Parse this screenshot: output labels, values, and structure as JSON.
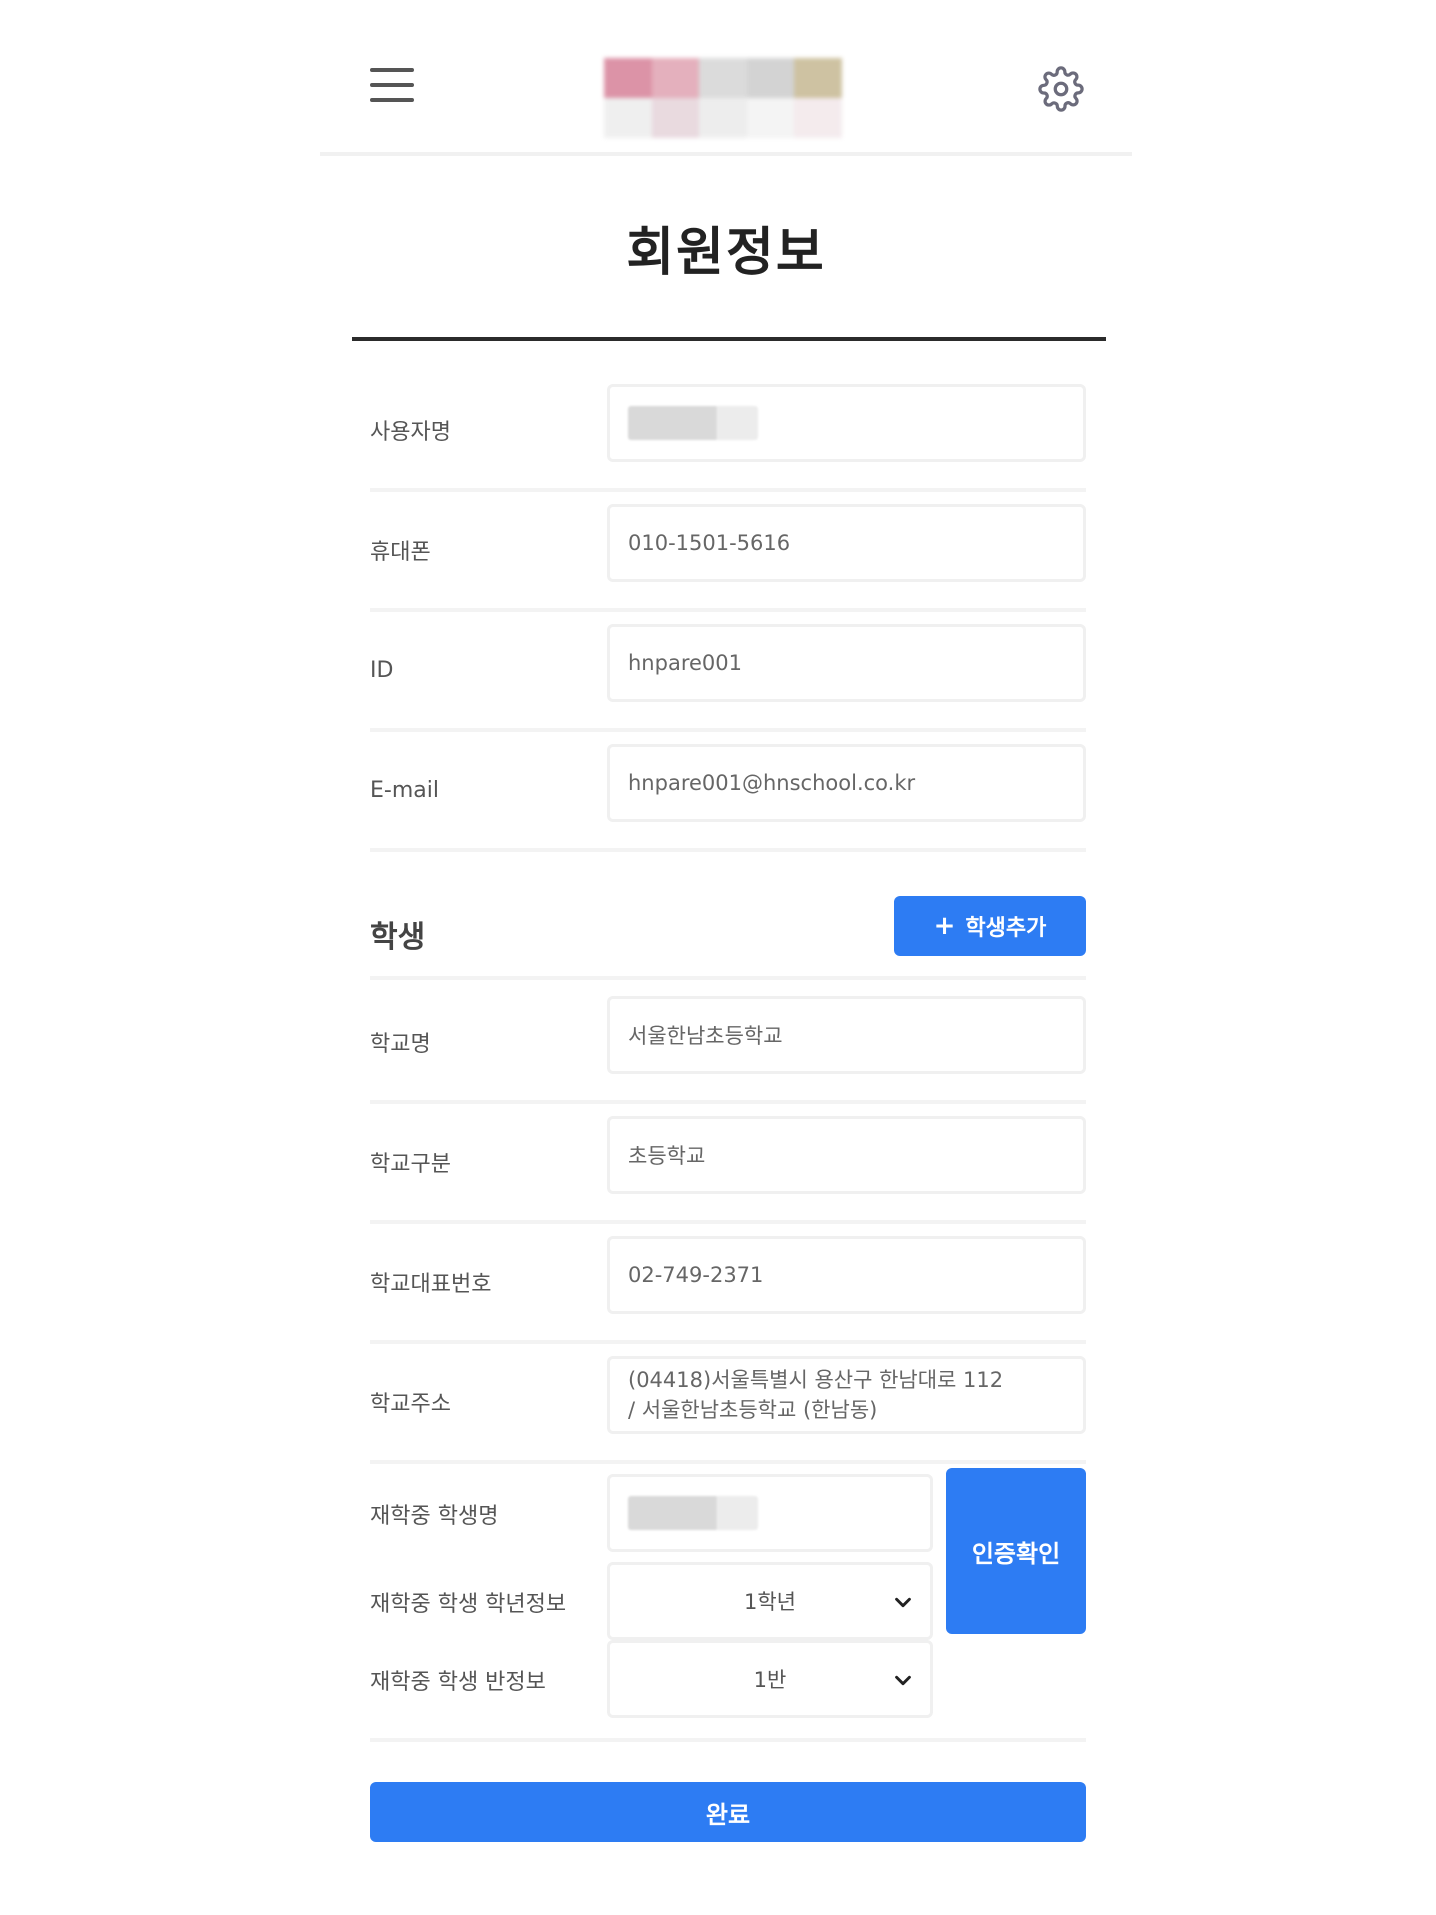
{
  "header": {
    "menu_icon": "hamburger-menu-icon",
    "logo_icon": "pixelated-logo",
    "settings_icon": "gear-icon",
    "logo_colors": [
      "#d9889e",
      "#e2a8b6",
      "#d8d8d8",
      "#cfcfcf",
      "#c9bc98",
      "#eeeeee",
      "#e7d6dc",
      "#ececec",
      "#f3f3f3",
      "#f3e9ec"
    ]
  },
  "page_title": "회원정보",
  "member": {
    "username_label": "사용자명",
    "phone_label": "휴대폰",
    "phone_value": "010-1501-5616",
    "id_label": "ID",
    "id_value": "hnpare001",
    "email_label": "E-mail",
    "email_value": "hnpare001@hnschool.co.kr"
  },
  "student": {
    "section_title": "학생",
    "add_button_label": "학생추가",
    "add_button_icon": "plus-icon",
    "school_name_label": "학교명",
    "school_name_value": "서울한남초등학교",
    "school_type_label": "학교구분",
    "school_type_value": "초등학교",
    "school_phone_label": "학교대표번호",
    "school_phone_value": "02-749-2371",
    "school_address_label": "학교주소",
    "school_address_line1": "(04418)서울특별시 용산구 한남대로 112",
    "school_address_line2": "/ 서울한남초등학교 (한남동)",
    "student_name_label": "재학중 학생명",
    "grade_label": "재학중 학생 학년정보",
    "grade_value": "1학년",
    "class_label": "재학중 학생 반정보",
    "class_value": "1반",
    "verify_button_label": "인증확인"
  },
  "footer": {
    "done_button_label": "완료"
  },
  "colors": {
    "primary": "#2d7cf3",
    "title_rule": "#2b2b2b"
  }
}
